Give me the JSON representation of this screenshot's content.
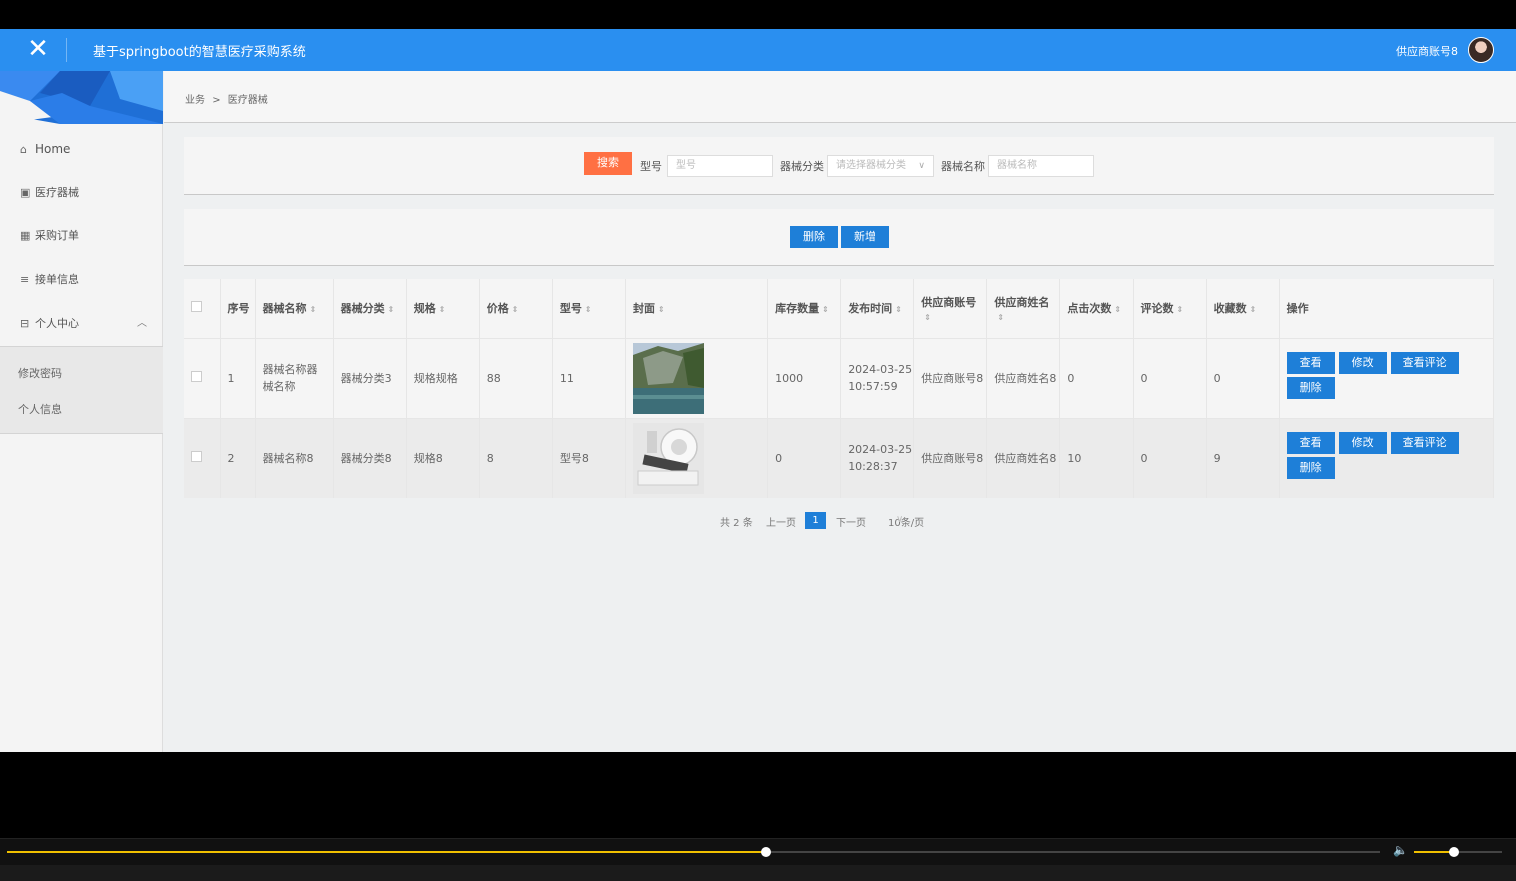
{
  "header": {
    "close_icon": "close-icon",
    "title": "基于springboot的智慧医疗采购系统",
    "username": "供应商账号8",
    "accent_color": "#2a8ff0"
  },
  "sidebar": {
    "items": [
      {
        "icon": "home-icon",
        "label": "Home"
      },
      {
        "icon": "chart-icon",
        "label": "医疗器械"
      },
      {
        "icon": "grid-icon",
        "label": "采购订单"
      },
      {
        "icon": "list-icon",
        "label": "接单信息"
      },
      {
        "icon": "card-icon",
        "label": "个人中心"
      }
    ],
    "subitems": [
      "修改密码",
      "个人信息"
    ]
  },
  "breadcrumb": {
    "root": "业务",
    "sep": ">",
    "current": "医疗器械"
  },
  "search": {
    "button": "搜索",
    "model_label": "型号",
    "model_placeholder": "型号",
    "category_label": "器械分类",
    "category_placeholder": "请选择器械分类",
    "name_label": "器械名称",
    "name_placeholder": "器械名称"
  },
  "actions": {
    "delete": "删除",
    "add": "新增"
  },
  "table": {
    "headers": [
      "序号",
      "器械名称",
      "器械分类",
      "规格",
      "价格",
      "型号",
      "封面",
      "库存数量",
      "发布时间",
      "供应商账号",
      "供应商姓名",
      "点击次数",
      "评论数",
      "收藏数",
      "操作"
    ],
    "rows": [
      {
        "index": "1",
        "name": "器械名称器械名称",
        "category": "器械分类3",
        "spec": "规格规格",
        "price": "88",
        "model": "11",
        "cover": "landscape-photo",
        "stock": "1000",
        "date": "2024-03-25",
        "time": "10:57:59",
        "account": "供应商账号8",
        "supplier": "供应商姓名8",
        "clicks": "0",
        "comments": "0",
        "favorites": "0"
      },
      {
        "index": "2",
        "name": "器械名称8",
        "category": "器械分类8",
        "spec": "规格8",
        "price": "8",
        "model": "型号8",
        "cover": "medical-device-photo",
        "stock": "0",
        "date": "2024-03-25",
        "time": "10:28:37",
        "account": "供应商账号8",
        "supplier": "供应商姓名8",
        "clicks": "10",
        "comments": "0",
        "favorites": "9"
      }
    ],
    "ops": {
      "view": "查看",
      "edit": "修改",
      "view_comments": "查看评论",
      "delete": "删除"
    }
  },
  "pager": {
    "total": "共 2 条",
    "prev": "上一页",
    "current": "1",
    "next": "下一页",
    "page_size": "10条/页"
  },
  "video": {
    "progress": 0.553,
    "volume": 0.45
  }
}
